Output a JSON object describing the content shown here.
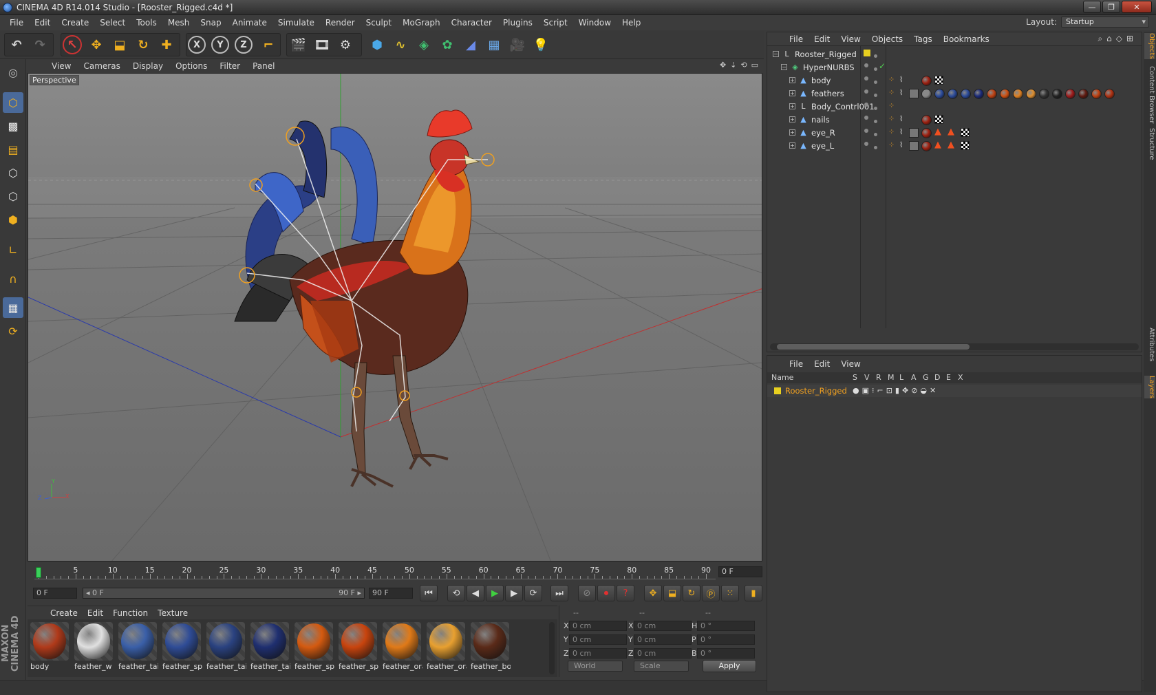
{
  "window": {
    "title": "CINEMA 4D R14.014 Studio - [Rooster_Rigged.c4d *]",
    "buttons": {
      "minimize": "—",
      "restore": "❐",
      "close": "✕"
    }
  },
  "menubar": {
    "items": [
      "File",
      "Edit",
      "Create",
      "Select",
      "Tools",
      "Mesh",
      "Snap",
      "Animate",
      "Simulate",
      "Render",
      "Sculpt",
      "MoGraph",
      "Character",
      "Plugins",
      "Script",
      "Window",
      "Help"
    ],
    "layout_label": "Layout:",
    "layout_value": "Startup"
  },
  "viewport": {
    "menu": [
      "View",
      "Cameras",
      "Display",
      "Options",
      "Filter",
      "Panel"
    ],
    "label": "Perspective",
    "axis": {
      "x": "X",
      "y": "Y",
      "z": "Z"
    }
  },
  "timeline": {
    "ticks": [
      "0",
      "5",
      "10",
      "15",
      "20",
      "25",
      "30",
      "35",
      "40",
      "45",
      "50",
      "55",
      "60",
      "65",
      "70",
      "75",
      "80",
      "85",
      "90"
    ],
    "current_frame": "0 F",
    "start_field": "0 F",
    "range_start": "◂ 0 F",
    "range_end": "90 F ▸",
    "end_field": "90 F"
  },
  "materials": {
    "menu": [
      "Create",
      "Edit",
      "Function",
      "Texture"
    ],
    "items": [
      {
        "name": "body",
        "color": "#b03a1a"
      },
      {
        "name": "feather_w",
        "color": "#e0e0e0"
      },
      {
        "name": "feather_tai",
        "color": "#3a5fa8"
      },
      {
        "name": "feather_spi",
        "color": "#2f4c96"
      },
      {
        "name": "feather_tai",
        "color": "#2a4280"
      },
      {
        "name": "feather_tai",
        "color": "#1f2f70"
      },
      {
        "name": "feather_spi",
        "color": "#d45a10"
      },
      {
        "name": "feather_spi",
        "color": "#c8440e"
      },
      {
        "name": "feather_ora",
        "color": "#e07a18"
      },
      {
        "name": "feather_ora",
        "color": "#e8a030"
      },
      {
        "name": "feather_bo",
        "color": "#5a2a18"
      }
    ]
  },
  "coordinates": {
    "headers": [
      "--",
      "--",
      "--"
    ],
    "rows": [
      {
        "a": "X",
        "av": "0 cm",
        "b": "X",
        "bv": "0 cm",
        "c": "H",
        "cv": "0 °"
      },
      {
        "a": "Y",
        "av": "0 cm",
        "b": "Y",
        "bv": "0 cm",
        "c": "P",
        "cv": "0 °"
      },
      {
        "a": "Z",
        "av": "0 cm",
        "b": "Z",
        "bv": "0 cm",
        "c": "B",
        "cv": "0 °"
      }
    ],
    "mode": "World",
    "size_mode": "Scale",
    "apply": "Apply"
  },
  "branding": "MAXON CINEMA 4D",
  "objects": {
    "menu": [
      "File",
      "Edit",
      "View",
      "Objects",
      "Tags",
      "Bookmarks"
    ],
    "rows": [
      {
        "name": "Rooster_Rigged",
        "depth": 0,
        "icon": "null-icon"
      },
      {
        "name": "HyperNURBS",
        "depth": 1,
        "icon": "hypernurbs-icon"
      },
      {
        "name": "body",
        "depth": 2,
        "icon": "polygon-icon"
      },
      {
        "name": "feathers",
        "depth": 2,
        "icon": "polygon-icon"
      },
      {
        "name": "Body_Contrl001",
        "depth": 2,
        "icon": "null-icon"
      },
      {
        "name": "nails",
        "depth": 2,
        "icon": "polygon-icon"
      },
      {
        "name": "eye_R",
        "depth": 2,
        "icon": "polygon-icon"
      },
      {
        "name": "eye_L",
        "depth": 2,
        "icon": "polygon-icon"
      }
    ]
  },
  "layers": {
    "menu": [
      "File",
      "Edit",
      "View"
    ],
    "columns": [
      "Name",
      "S",
      "V",
      "R",
      "M",
      "L",
      "A",
      "G",
      "D",
      "E",
      "X"
    ],
    "row_name": "Rooster_Rigged",
    "row_color": "#e8d020"
  },
  "sidetabs": [
    "Objects",
    "Content Browser",
    "Structure",
    "Attributes",
    "Layers"
  ]
}
